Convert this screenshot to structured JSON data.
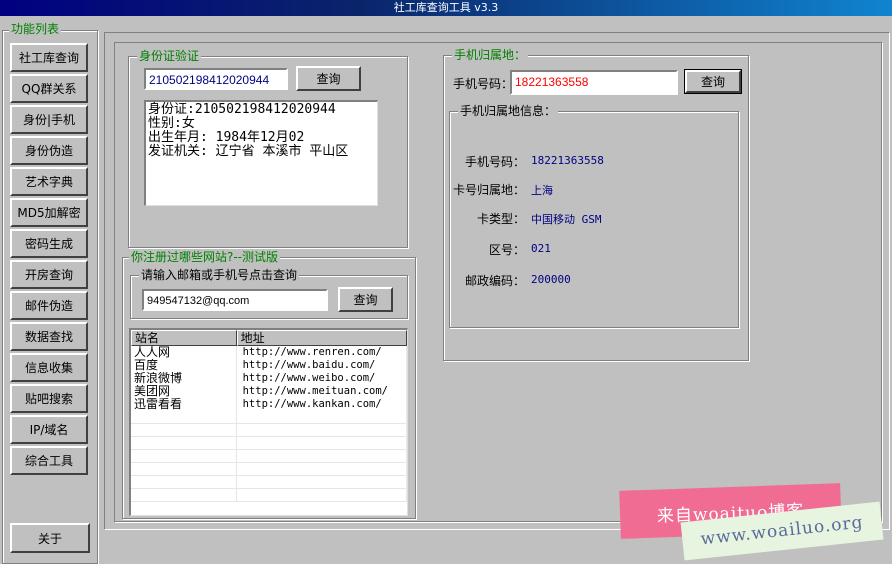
{
  "window": {
    "title": "社工库查询工具 v3.3"
  },
  "sidebar": {
    "title": "功能列表",
    "items": [
      "社工库查询",
      "QQ群关系",
      "身份|手机",
      "身份伪造",
      "艺术字典",
      "MD5加解密",
      "密码生成",
      "开房查询",
      "邮件伪造",
      "数据查找",
      "信息收集",
      "贴吧搜索",
      "IP/域名",
      "综合工具"
    ],
    "about": "关于"
  },
  "id_check": {
    "legend": "身份证验证",
    "input_value": "210502198412020944",
    "query_label": "查询",
    "result_lines": [
      "身份证:210502198412020944",
      "性别:女",
      "出生年月: 1984年12月02",
      "发证机关: 辽宁省 本溪市 平山区"
    ]
  },
  "site_reg": {
    "legend": "你注册过哪些网站?--测试版",
    "sub_legend": "请输入邮箱或手机号点击查询",
    "input_value": "949547132@qq.com",
    "query_label": "查询",
    "columns": [
      "站名",
      "地址"
    ],
    "rows": [
      [
        "人人网",
        "http://www.renren.com/"
      ],
      [
        "百度",
        "http://www.baidu.com/"
      ],
      [
        "新浪微博",
        "http://www.weibo.com/"
      ],
      [
        "美团网",
        "http://www.meituan.com/"
      ],
      [
        "迅雷看看",
        "http://www.kankan.com/"
      ]
    ]
  },
  "phone": {
    "legend": "手机归属地：",
    "number_label": "手机号码：",
    "number_value": "18221363558",
    "query_label": "查询",
    "info_legend": "手机归属地信息：",
    "info": [
      {
        "label": "手机号码：",
        "value": "18221363558"
      },
      {
        "label": "卡号归属地：",
        "value": "上海"
      },
      {
        "label": "卡类型：",
        "value": "中国移动 GSM"
      },
      {
        "label": "区号：",
        "value": "021"
      },
      {
        "label": "邮政编码：",
        "value": "200000"
      }
    ]
  },
  "watermark": {
    "line1": "来自woaituo博客",
    "line2": "www.woailuo.org"
  },
  "colors": {
    "legend_green": "#008000",
    "phone_red": "#ff0000",
    "info_blue": "#000080"
  }
}
